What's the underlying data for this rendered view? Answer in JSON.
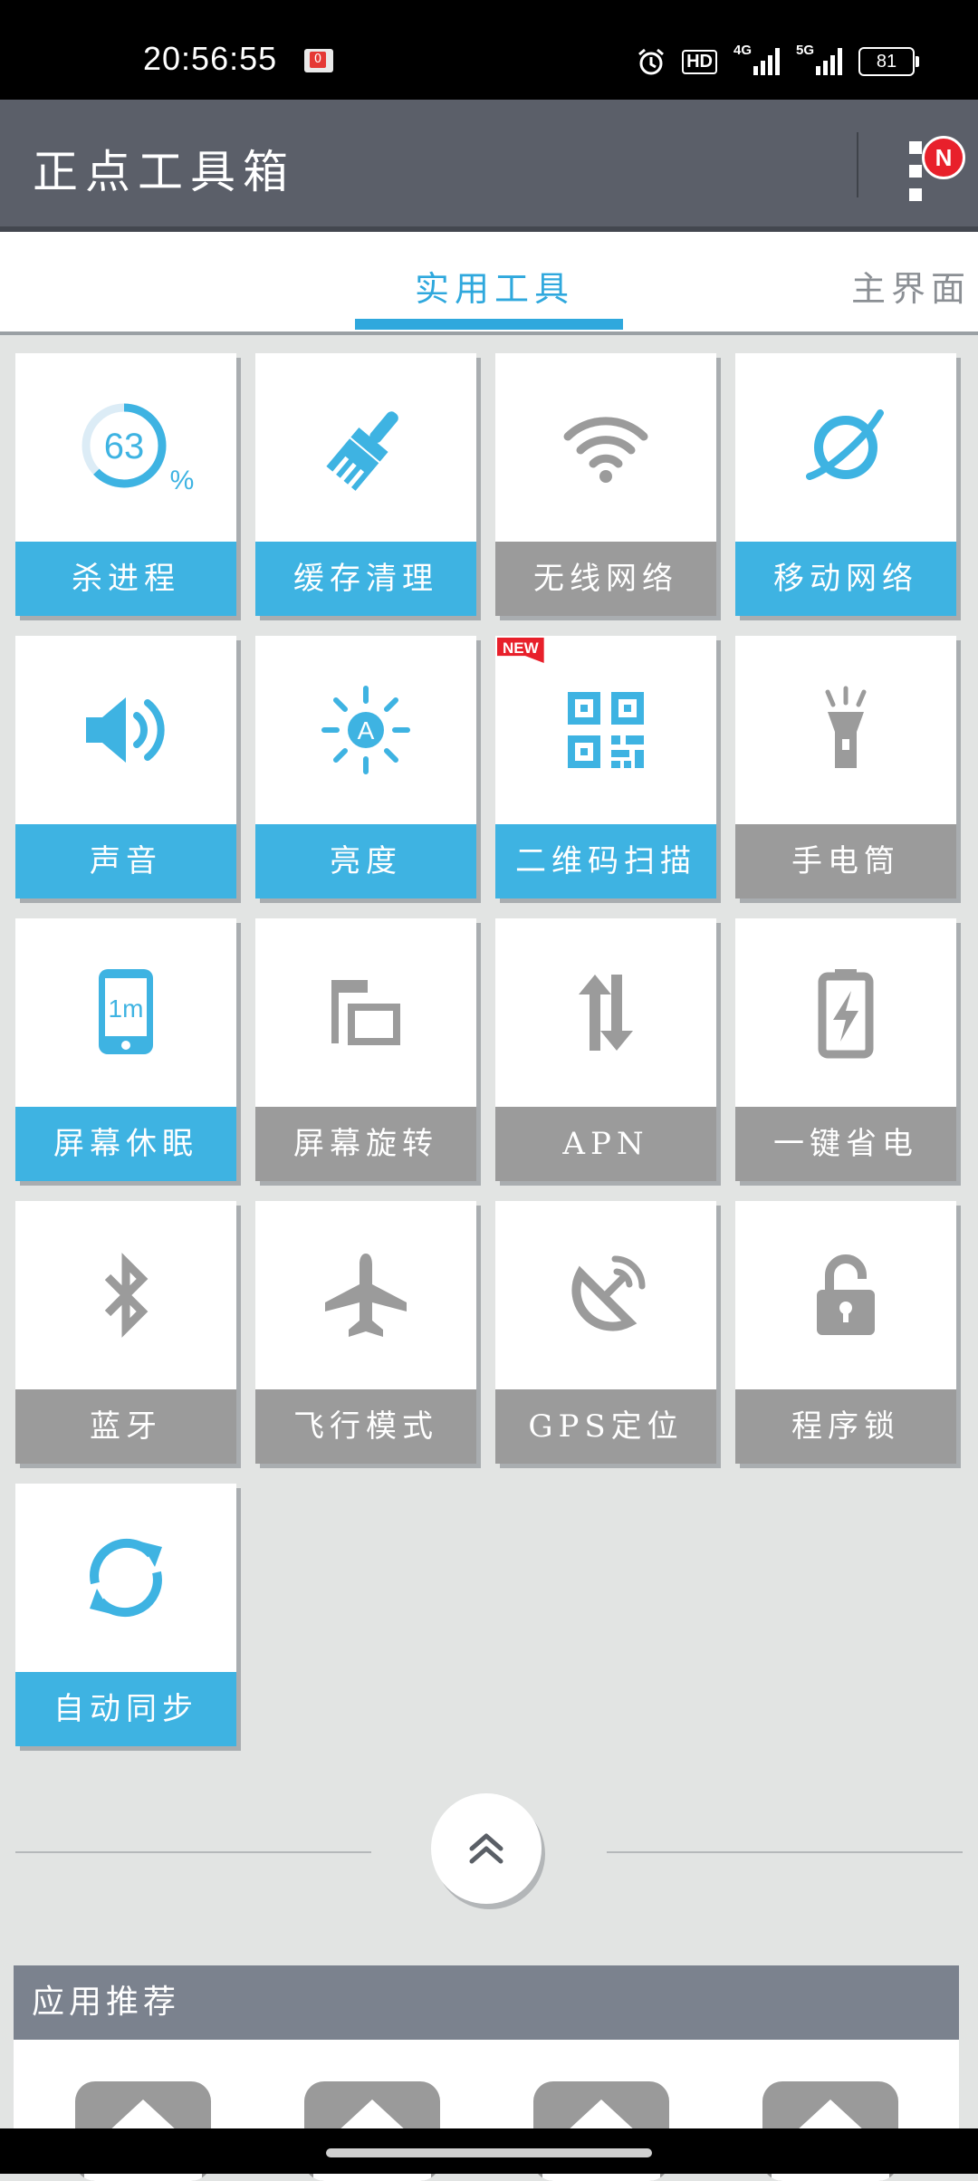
{
  "status_bar": {
    "time": "20:56:55",
    "notification_count": "0",
    "hd_label": "HD",
    "net1": "4G",
    "net2": "5G",
    "battery": "81"
  },
  "app_bar": {
    "title": "正点工具箱",
    "menu_badge": "N"
  },
  "tabs": [
    {
      "label": "实用工具",
      "active": true
    },
    {
      "label": "主界面",
      "active": false
    }
  ],
  "tools": [
    {
      "label": "杀进程",
      "active": true,
      "icon": "memory-ring-icon",
      "value": "63",
      "unit": "%"
    },
    {
      "label": "缓存清理",
      "active": true,
      "icon": "broom-icon"
    },
    {
      "label": "无线网络",
      "active": false,
      "icon": "wifi-icon"
    },
    {
      "label": "移动网络",
      "active": true,
      "icon": "globe-orbit-icon"
    },
    {
      "label": "声音",
      "active": true,
      "icon": "speaker-icon"
    },
    {
      "label": "亮度",
      "active": true,
      "icon": "brightness-auto-icon"
    },
    {
      "label": "二维码扫描",
      "active": true,
      "icon": "qr-code-icon",
      "badge": "NEW"
    },
    {
      "label": "手电筒",
      "active": false,
      "icon": "flashlight-icon"
    },
    {
      "label": "屏幕休眠",
      "active": true,
      "icon": "screen-timeout-icon",
      "value": "1m"
    },
    {
      "label": "屏幕旋转",
      "active": false,
      "icon": "screen-rotate-icon"
    },
    {
      "label": "APN",
      "active": false,
      "icon": "data-arrows-icon"
    },
    {
      "label": "一键省电",
      "active": false,
      "icon": "battery-save-icon"
    },
    {
      "label": "蓝牙",
      "active": false,
      "icon": "bluetooth-icon"
    },
    {
      "label": "飞行模式",
      "active": false,
      "icon": "airplane-icon"
    },
    {
      "label": "GPS定位",
      "active": false,
      "icon": "gps-satellite-icon"
    },
    {
      "label": "程序锁",
      "active": false,
      "icon": "lock-icon"
    },
    {
      "label": "自动同步",
      "active": true,
      "icon": "sync-icon"
    }
  ],
  "colors": {
    "accent": "#3eb3e2",
    "inactive": "#9b9b9b",
    "app_bar": "#5b5f69",
    "background": "#e2e4e3"
  },
  "recommended": {
    "title": "应用推荐",
    "apps": [
      {
        "icon": "app-placeholder-icon"
      },
      {
        "icon": "app-placeholder-icon"
      },
      {
        "icon": "app-placeholder-icon"
      },
      {
        "icon": "app-placeholder-icon"
      }
    ]
  }
}
